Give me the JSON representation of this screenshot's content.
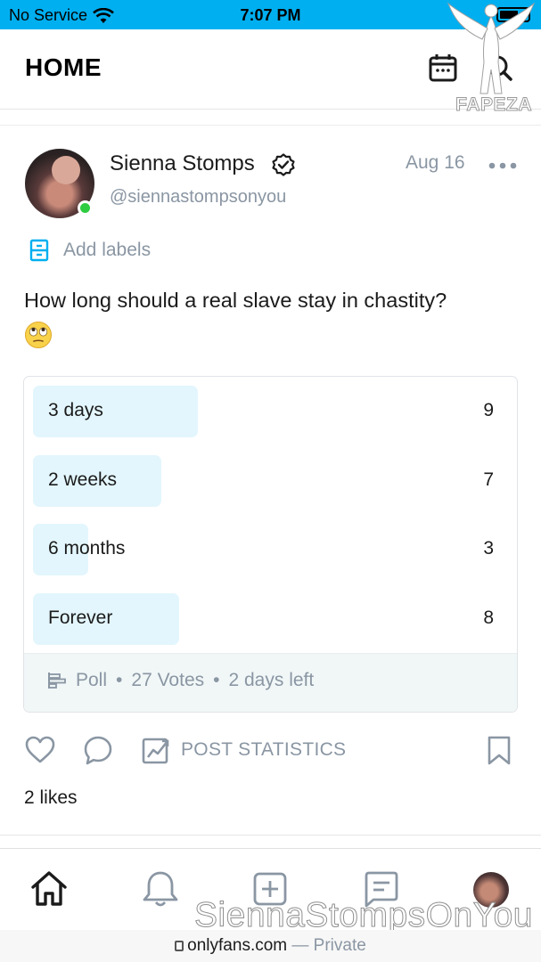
{
  "status_bar": {
    "carrier": "No Service",
    "time": "7:07 PM"
  },
  "header": {
    "title": "HOME",
    "calendar_icon": "calendar-icon",
    "search_icon": "search-icon",
    "watermark": "FAPEZA"
  },
  "post": {
    "author_name": "Sienna Stomps",
    "author_handle": "@siennastompsonyou",
    "date": "Aug 16",
    "add_labels": "Add labels",
    "text": "How long should a real slave stay in chastity?",
    "emoji": "face-with-rolling-eyes"
  },
  "poll": {
    "options": [
      {
        "label": "3 days",
        "count": "9",
        "share": 0.333
      },
      {
        "label": "2 weeks",
        "count": "7",
        "share": 0.259
      },
      {
        "label": "6 months",
        "count": "3",
        "share": 0.111
      },
      {
        "label": "Forever",
        "count": "8",
        "share": 0.296
      }
    ],
    "type_label": "Poll",
    "votes": "27 Votes",
    "time_left": "2 days left",
    "separator": "•"
  },
  "actions": {
    "stats_label": "POST STATISTICS",
    "likes": "2 likes"
  },
  "tabbar": {
    "watermark": "SiennaStompsOnYou"
  },
  "urlbar": {
    "domain": "onlyfans.com",
    "mode": "— Private"
  },
  "colors": {
    "accent": "#00aff0",
    "muted": "#8a96a3",
    "poll_bar": "#e3f6fd",
    "online": "#2ecc40"
  }
}
